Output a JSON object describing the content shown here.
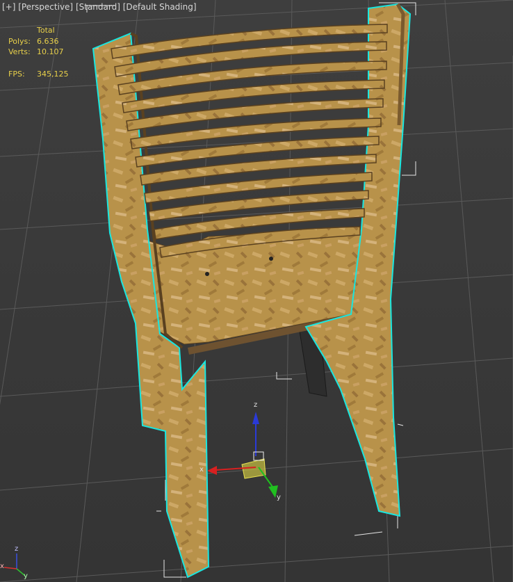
{
  "viewport": {
    "label_plus": "[+]",
    "label_view": "[Perspective]",
    "label_mode": "[Standard]",
    "label_shading": "[Default Shading]"
  },
  "stats": {
    "header": "Total",
    "polys_label": "Polys:",
    "polys_value": "6.636",
    "verts_label": "Verts:",
    "verts_value": "10.107",
    "fps_label": "FPS:",
    "fps_value": "345,125"
  },
  "gizmo": {
    "x": "x",
    "y": "y",
    "z": "z"
  },
  "axis_tripod": {
    "x": "x",
    "y": "y",
    "z": "z"
  },
  "colors": {
    "selection_outline": "#19e6e0",
    "stats_text": "#e8d04a",
    "wood": "#b8924a",
    "grid": "#5c5c5c"
  }
}
